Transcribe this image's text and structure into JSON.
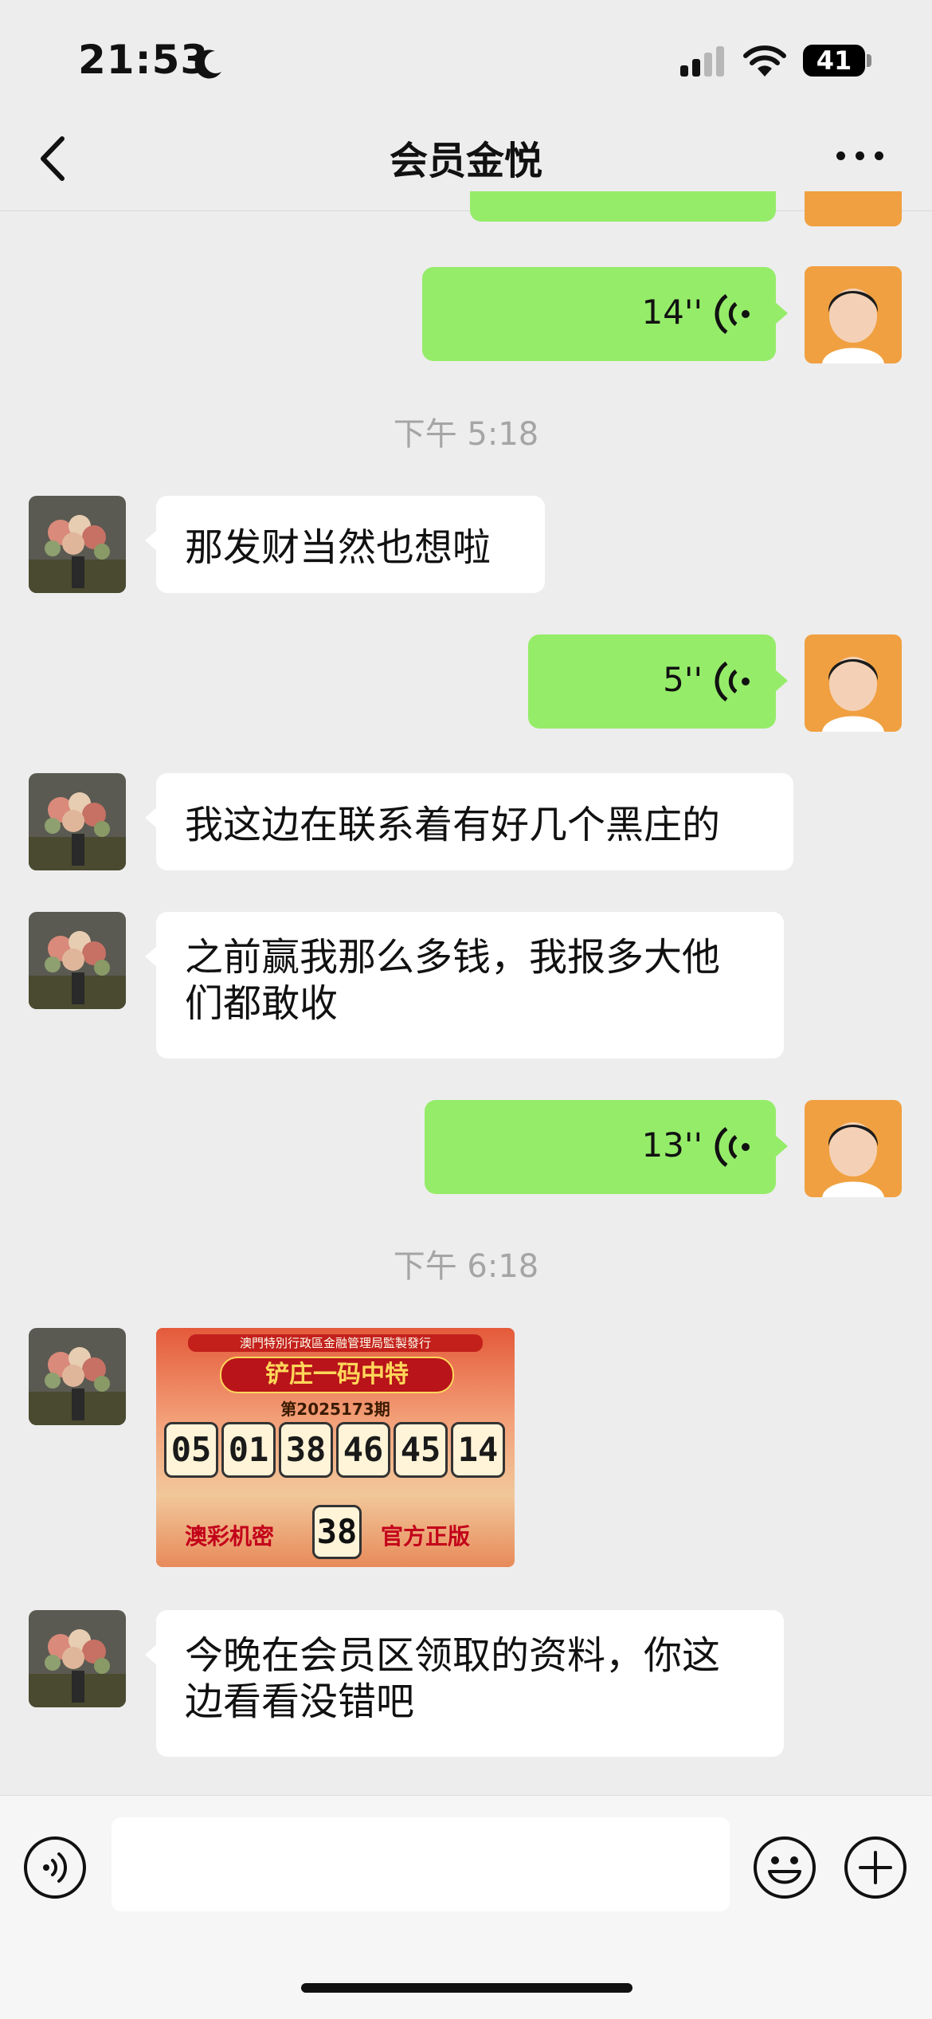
{
  "status_bar": {
    "time": "21:53",
    "battery": "41"
  },
  "nav": {
    "title": "会员金悦"
  },
  "messages": [
    {
      "type": "voice",
      "side": "right",
      "duration": "14''"
    },
    {
      "type": "timestamp",
      "text": "下午 5:18"
    },
    {
      "type": "text",
      "side": "left",
      "text": "那发财当然也想啦"
    },
    {
      "type": "voice",
      "side": "right",
      "duration": "5''"
    },
    {
      "type": "text",
      "side": "left",
      "text": "我这边在联系着有好几个黑庄的"
    },
    {
      "type": "text",
      "side": "left",
      "text": "之前赢我那么多钱，我报多大他们都敢收"
    },
    {
      "type": "voice",
      "side": "right",
      "duration": "13''"
    },
    {
      "type": "timestamp",
      "text": "下午 6:18"
    },
    {
      "type": "image",
      "side": "left"
    },
    {
      "type": "text",
      "side": "left",
      "text": "今晚在会员区领取的资料，你这边看看没错吧"
    }
  ],
  "lottery": {
    "header": "澳門特別行政區金融管理局監製發行",
    "title": "铲庄一码中特",
    "issue": "第2025173期",
    "numbers": [
      "05",
      "01",
      "38",
      "46",
      "45",
      "14"
    ],
    "special": "38",
    "left_label": "澳彩机密",
    "right_label": "官方正版"
  },
  "colors": {
    "bubble_mine": "#95ec69",
    "bubble_other": "#ffffff",
    "background": "#ededed"
  },
  "icons": [
    "moon-icon",
    "signal-icon",
    "wifi-icon",
    "back-chevron-icon",
    "more-icon",
    "voice-wave-icon",
    "voice-toggle-icon",
    "emoji-icon",
    "plus-icon"
  ]
}
